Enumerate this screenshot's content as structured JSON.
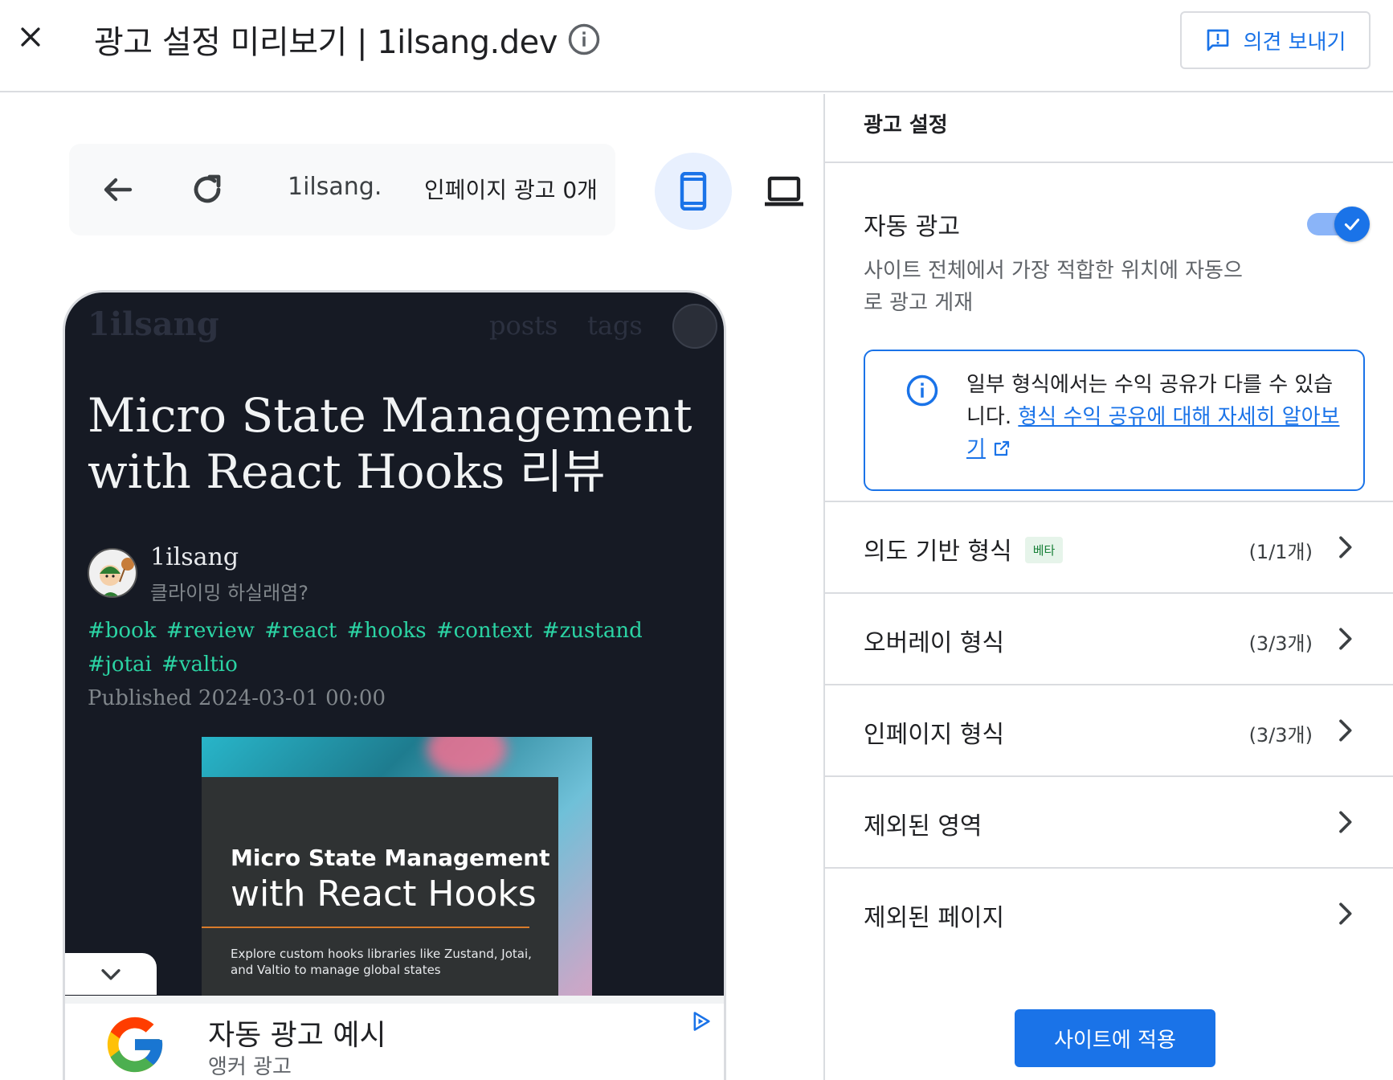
{
  "header": {
    "title": "광고 설정 미리보기 | 1ilsang.dev",
    "feedback_label": "의견 보내기"
  },
  "preview_bar": {
    "url": "1ilsang.",
    "inpage_count": "인페이지 광고 0개"
  },
  "site": {
    "logo": "1ilsang",
    "nav": [
      "posts",
      "tags"
    ],
    "post_title": "Micro State Management with React Hooks 리뷰",
    "author_name": "1ilsang",
    "author_bio": "클라이밍 하실래염?",
    "tags": "#book #review #react #hooks #context #zustand #jotai #valtio",
    "published": "Published 2024-03-01 00:00",
    "book": {
      "title_line1": "Micro State Management",
      "title_line2": "with React Hooks",
      "description": "Explore custom hooks libraries like Zustand, Jotai, and Valtio to manage global states"
    }
  },
  "anchor_ad": {
    "title": "자동 광고 예시",
    "subtitle": "앵커 광고"
  },
  "settings": {
    "section_title": "광고 설정",
    "auto_ads_label": "자동 광고",
    "auto_ads_enabled": true,
    "auto_ads_desc": "사이트 전체에서 가장 적합한 위치에 자동으로 광고 게재",
    "info_text": "일부 형식에서는 수익 공유가 다를 수 있습니다.",
    "info_link": "형식 수익 공유에 대해 자세히 알아보기",
    "rows": [
      {
        "label": "의도 기반 형식",
        "badge": "베타",
        "count": "(1/1개)"
      },
      {
        "label": "오버레이 형식",
        "count": "(3/3개)"
      },
      {
        "label": "인페이지 형식",
        "count": "(3/3개)"
      },
      {
        "label": "제외된 영역"
      },
      {
        "label": "제외된 페이지"
      }
    ],
    "apply_label": "사이트에 적용"
  },
  "colors": {
    "accent": "#1a73e8",
    "site_bg": "#161a24",
    "tag_green": "#2bd4a4"
  }
}
